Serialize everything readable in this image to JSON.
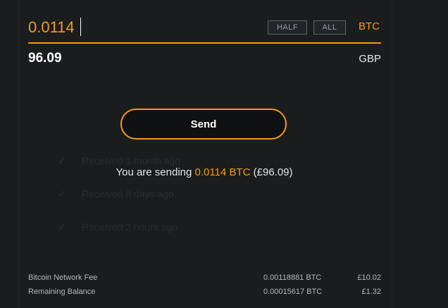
{
  "amount": {
    "value": "0.0114",
    "half_label": "HALF",
    "all_label": "ALL",
    "currency": "BTC"
  },
  "fiat": {
    "value": "96.09",
    "currency": "GBP"
  },
  "send": {
    "label": "Send"
  },
  "summary": {
    "prefix": "You are sending ",
    "amount": "0.0114 BTC",
    "fiat": " (£96.09)"
  },
  "background_history": [
    {
      "text": "Received 1 month ago",
      "icon": "check-icon"
    },
    {
      "text": "Received 8 days ago",
      "icon": "check-icon"
    },
    {
      "text": "Received 2 hours ago",
      "icon": "check-icon"
    }
  ],
  "fees": [
    {
      "label": "Bitcoin Network Fee",
      "btc": "0.00118881 BTC",
      "fiat": "£10.02"
    },
    {
      "label": "Remaining Balance",
      "btc": "0.00015617 BTC",
      "fiat": "£1.32"
    }
  ],
  "colors": {
    "accent": "#f39c12",
    "background": "#1b1c1e",
    "text": "#e6e6e6"
  }
}
